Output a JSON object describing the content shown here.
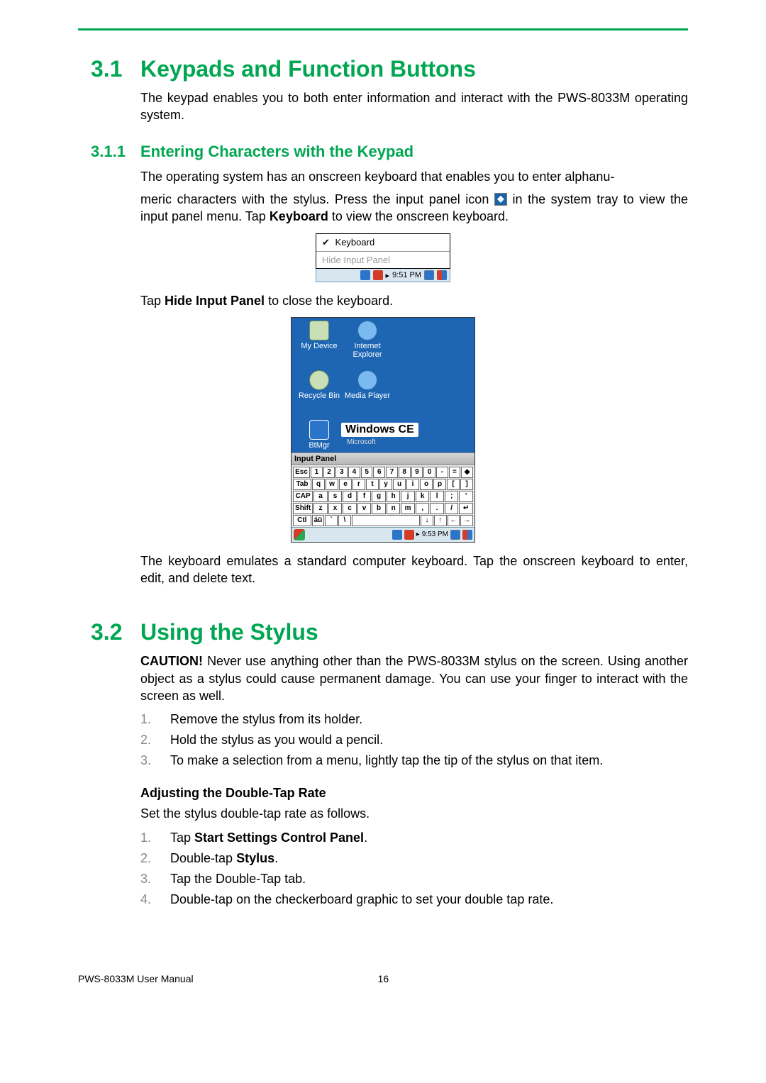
{
  "section31": {
    "num": "3.1",
    "title": "Keypads and Function Buttons",
    "intro": "The keypad enables you to both enter information and interact with the PWS-8033M operating system."
  },
  "section311": {
    "num": "3.1.1",
    "title": "Entering Characters with the Keypad",
    "p1a": "The operating system has an onscreen keyboard that enables you to enter alphanu-",
    "p1b_prefix": "meric characters with the stylus. Press the input panel icon ",
    "p1b_suffix": " in the system tray to view the input panel menu. Tap ",
    "p1b_bold": "Keyboard",
    "p1b_tail": " to view the onscreen keyboard.",
    "p2_prefix": "Tap ",
    "p2_bold": "Hide Input Panel",
    "p2_suffix": " to close the keyboard.",
    "p3": "The keyboard emulates a standard computer keyboard. Tap the onscreen keyboard to enter, edit, and delete text."
  },
  "fig1": {
    "menu_keyboard": "Keyboard",
    "menu_hide": "Hide Input Panel",
    "time": "9:51 PM"
  },
  "fig2": {
    "icons": {
      "mydevice": "My Device",
      "ie": "Internet Explorer",
      "recycle": "Recycle Bin",
      "media": "Media Player",
      "btmgr": "BtMgr",
      "wordpad": "Microsoft"
    },
    "wince": "Windows CE",
    "input_panel": "Input Panel",
    "rows": {
      "r1": [
        "Esc",
        "1",
        "2",
        "3",
        "4",
        "5",
        "6",
        "7",
        "8",
        "9",
        "0",
        "-",
        "=",
        "◆"
      ],
      "r2": [
        "Tab",
        "q",
        "w",
        "e",
        "r",
        "t",
        "y",
        "u",
        "i",
        "o",
        "p",
        "[",
        "]"
      ],
      "r3": [
        "CAP",
        "a",
        "s",
        "d",
        "f",
        "g",
        "h",
        "j",
        "k",
        "l",
        ";",
        "'"
      ],
      "r4": [
        "Shift",
        "z",
        "x",
        "c",
        "v",
        "b",
        "n",
        "m",
        ",",
        ".",
        "/",
        "↵"
      ],
      "r5": [
        "Ctl",
        "áü",
        "`",
        "\\",
        " ",
        "↓",
        "↑",
        "←",
        "→"
      ]
    },
    "time": "9:53 PM"
  },
  "section32": {
    "num": "3.2",
    "title": "Using the Stylus",
    "caution_label": "CAUTION!",
    "caution": "Never use anything other than the PWS-8033M stylus on the screen. Using another object as a stylus could cause permanent damage. You can use your finger to interact with the screen as well.",
    "steps": [
      "Remove the stylus from its holder.",
      "Hold the stylus as you would a pencil.",
      "To make a selection from a menu, lightly tap the tip of the stylus on that item."
    ],
    "subhead": "Adjusting the Double-Tap Rate",
    "subintro": "Set the stylus double-tap rate as follows.",
    "steps2": [
      {
        "pre": "Tap ",
        "bold": "Start  Settings Control Panel",
        "post": "."
      },
      {
        "pre": "Double-tap ",
        "bold": "Stylus",
        "post": "."
      },
      {
        "pre": "Tap the Double-Tap tab.",
        "bold": "",
        "post": ""
      },
      {
        "pre": "Double-tap on the checkerboard graphic to set your double tap rate.",
        "bold": "",
        "post": ""
      }
    ]
  },
  "footer": {
    "left": "PWS-8033M User Manual",
    "page": "16"
  }
}
